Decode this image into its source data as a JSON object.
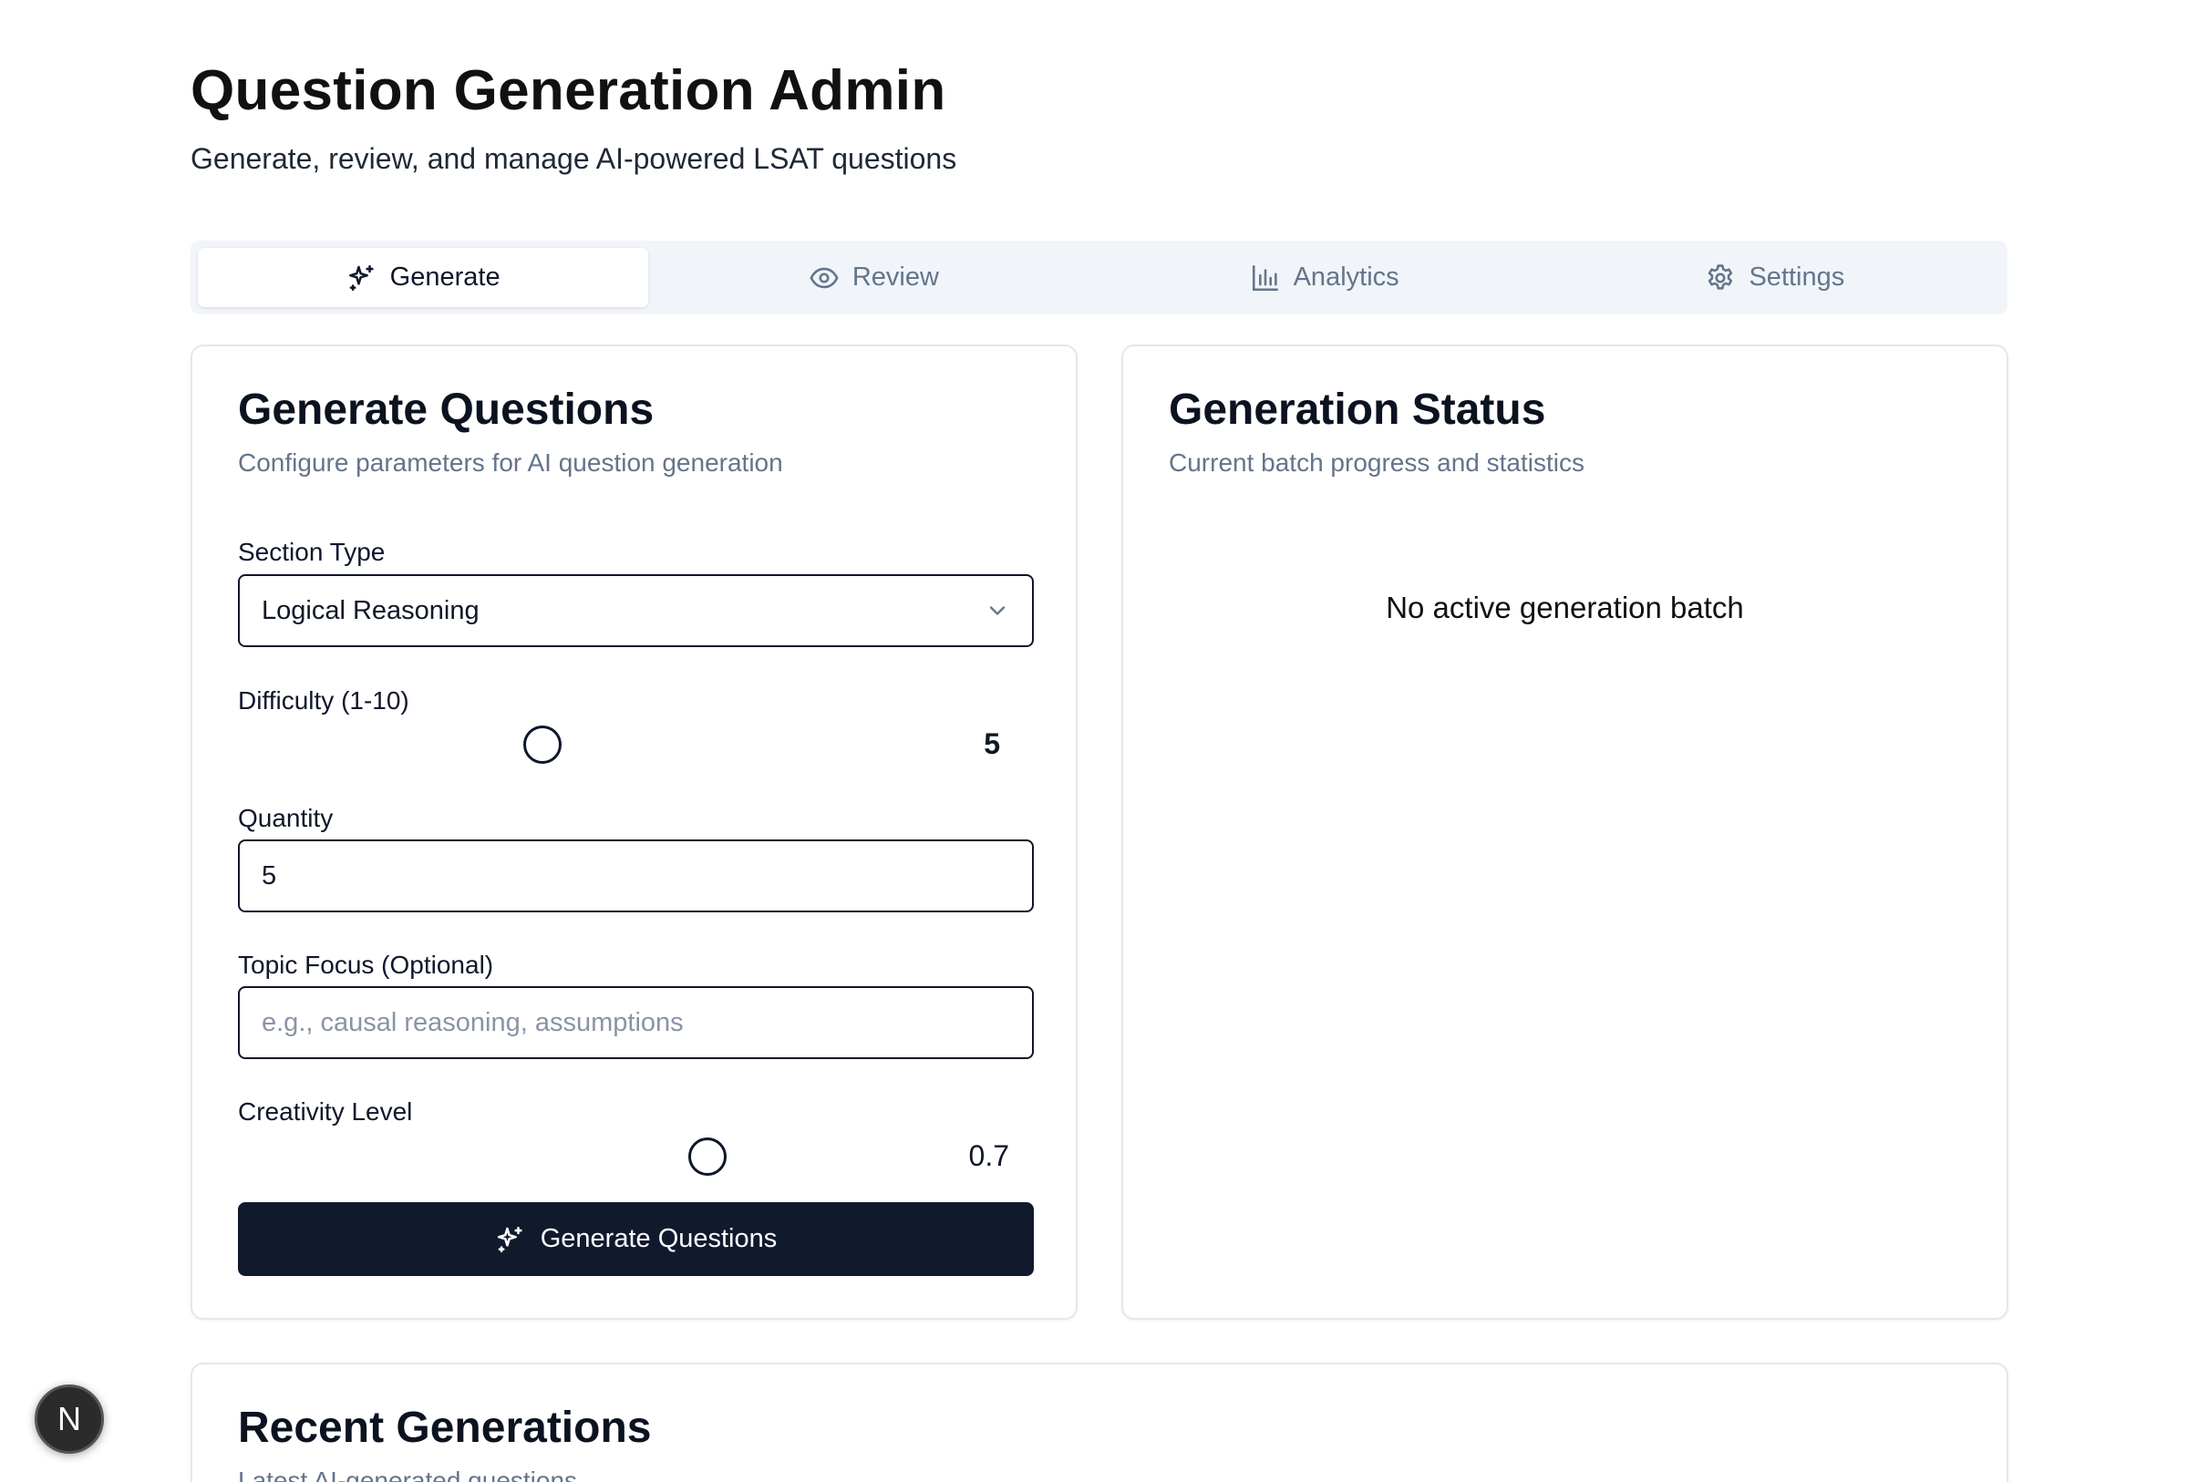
{
  "header": {
    "title": "Question Generation Admin",
    "subtitle": "Generate, review, and manage AI-powered LSAT questions"
  },
  "tabs": [
    {
      "label": "Generate",
      "icon": "sparkles-icon",
      "active": true
    },
    {
      "label": "Review",
      "icon": "eye-icon",
      "active": false
    },
    {
      "label": "Analytics",
      "icon": "bar-chart-icon",
      "active": false
    },
    {
      "label": "Settings",
      "icon": "gear-icon",
      "active": false
    }
  ],
  "generate": {
    "title": "Generate Questions",
    "description": "Configure parameters for AI question generation",
    "section_type_label": "Section Type",
    "section_type_value": "Logical Reasoning",
    "difficulty_label": "Difficulty (1-10)",
    "difficulty_value": "5",
    "difficulty_range": [
      1,
      10
    ],
    "quantity_label": "Quantity",
    "quantity_value": "5",
    "topic_label": "Topic Focus (Optional)",
    "topic_placeholder": "e.g., causal reasoning, assumptions",
    "creativity_label": "Creativity Level",
    "creativity_value": "0.7",
    "submit_label": "Generate Questions"
  },
  "status": {
    "title": "Generation Status",
    "description": "Current batch progress and statistics",
    "empty_message": "No active generation batch"
  },
  "recent": {
    "title": "Recent Generations",
    "description": "Latest AI-generated questions"
  },
  "fab": {
    "label": "N"
  },
  "colors": {
    "primary_button": "#111a2d",
    "tab_bar": "#f1f5f9",
    "muted_text": "#64748b"
  }
}
